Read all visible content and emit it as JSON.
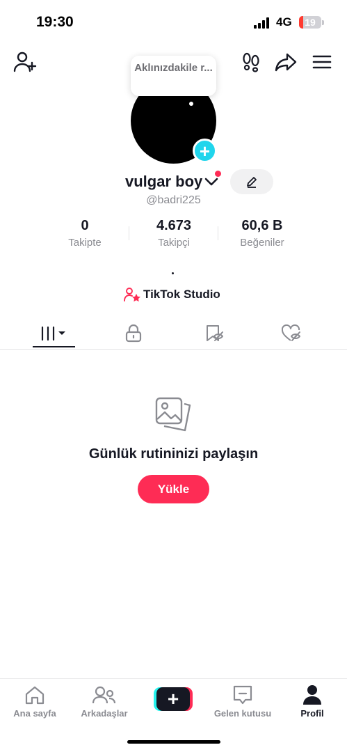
{
  "status_bar": {
    "time": "19:30",
    "network": "4G",
    "battery_level": 19,
    "battery_text": "19",
    "battery_color": "#ff3b30"
  },
  "top_bar": {
    "add_friend_icon": "add-user-icon",
    "footprints_icon": "footprints-icon",
    "share_icon": "share-icon",
    "menu_icon": "hamburger-menu-icon"
  },
  "profile": {
    "thought_bubble": "Aklınızdakile r...",
    "display_name": "vulgar boy",
    "handle": "@badri225",
    "bio": "."
  },
  "stats": [
    {
      "value": "0",
      "label": "Takipte"
    },
    {
      "value": "4.673",
      "label": "Takipçi"
    },
    {
      "value": "60,6 B",
      "label": "Beğeniler"
    }
  ],
  "studio": {
    "label": "TikTok Studio"
  },
  "tabs": [
    {
      "name": "videos",
      "icon": "grid-icon",
      "active": true
    },
    {
      "name": "private",
      "icon": "lock-icon",
      "active": false
    },
    {
      "name": "favorites",
      "icon": "bookmark-hidden-icon",
      "active": false
    },
    {
      "name": "liked",
      "icon": "heart-hidden-icon",
      "active": false
    }
  ],
  "empty_state": {
    "icon": "photos-icon",
    "title": "Günlük rutininizi paylaşın",
    "button": "Yükle"
  },
  "bottom_nav": {
    "items": [
      {
        "label": "Ana sayfa",
        "icon": "home-icon"
      },
      {
        "label": "Arkadaşlar",
        "icon": "friends-icon"
      },
      {
        "label": "",
        "icon": "create-plus-icon"
      },
      {
        "label": "Gelen kutusu",
        "icon": "inbox-icon"
      },
      {
        "label": "Profil",
        "icon": "profile-icon",
        "active": true
      }
    ]
  },
  "colors": {
    "accent": "#fe2c55",
    "cyan": "#25f4ee",
    "text": "#161823",
    "muted": "#8a8b91"
  }
}
